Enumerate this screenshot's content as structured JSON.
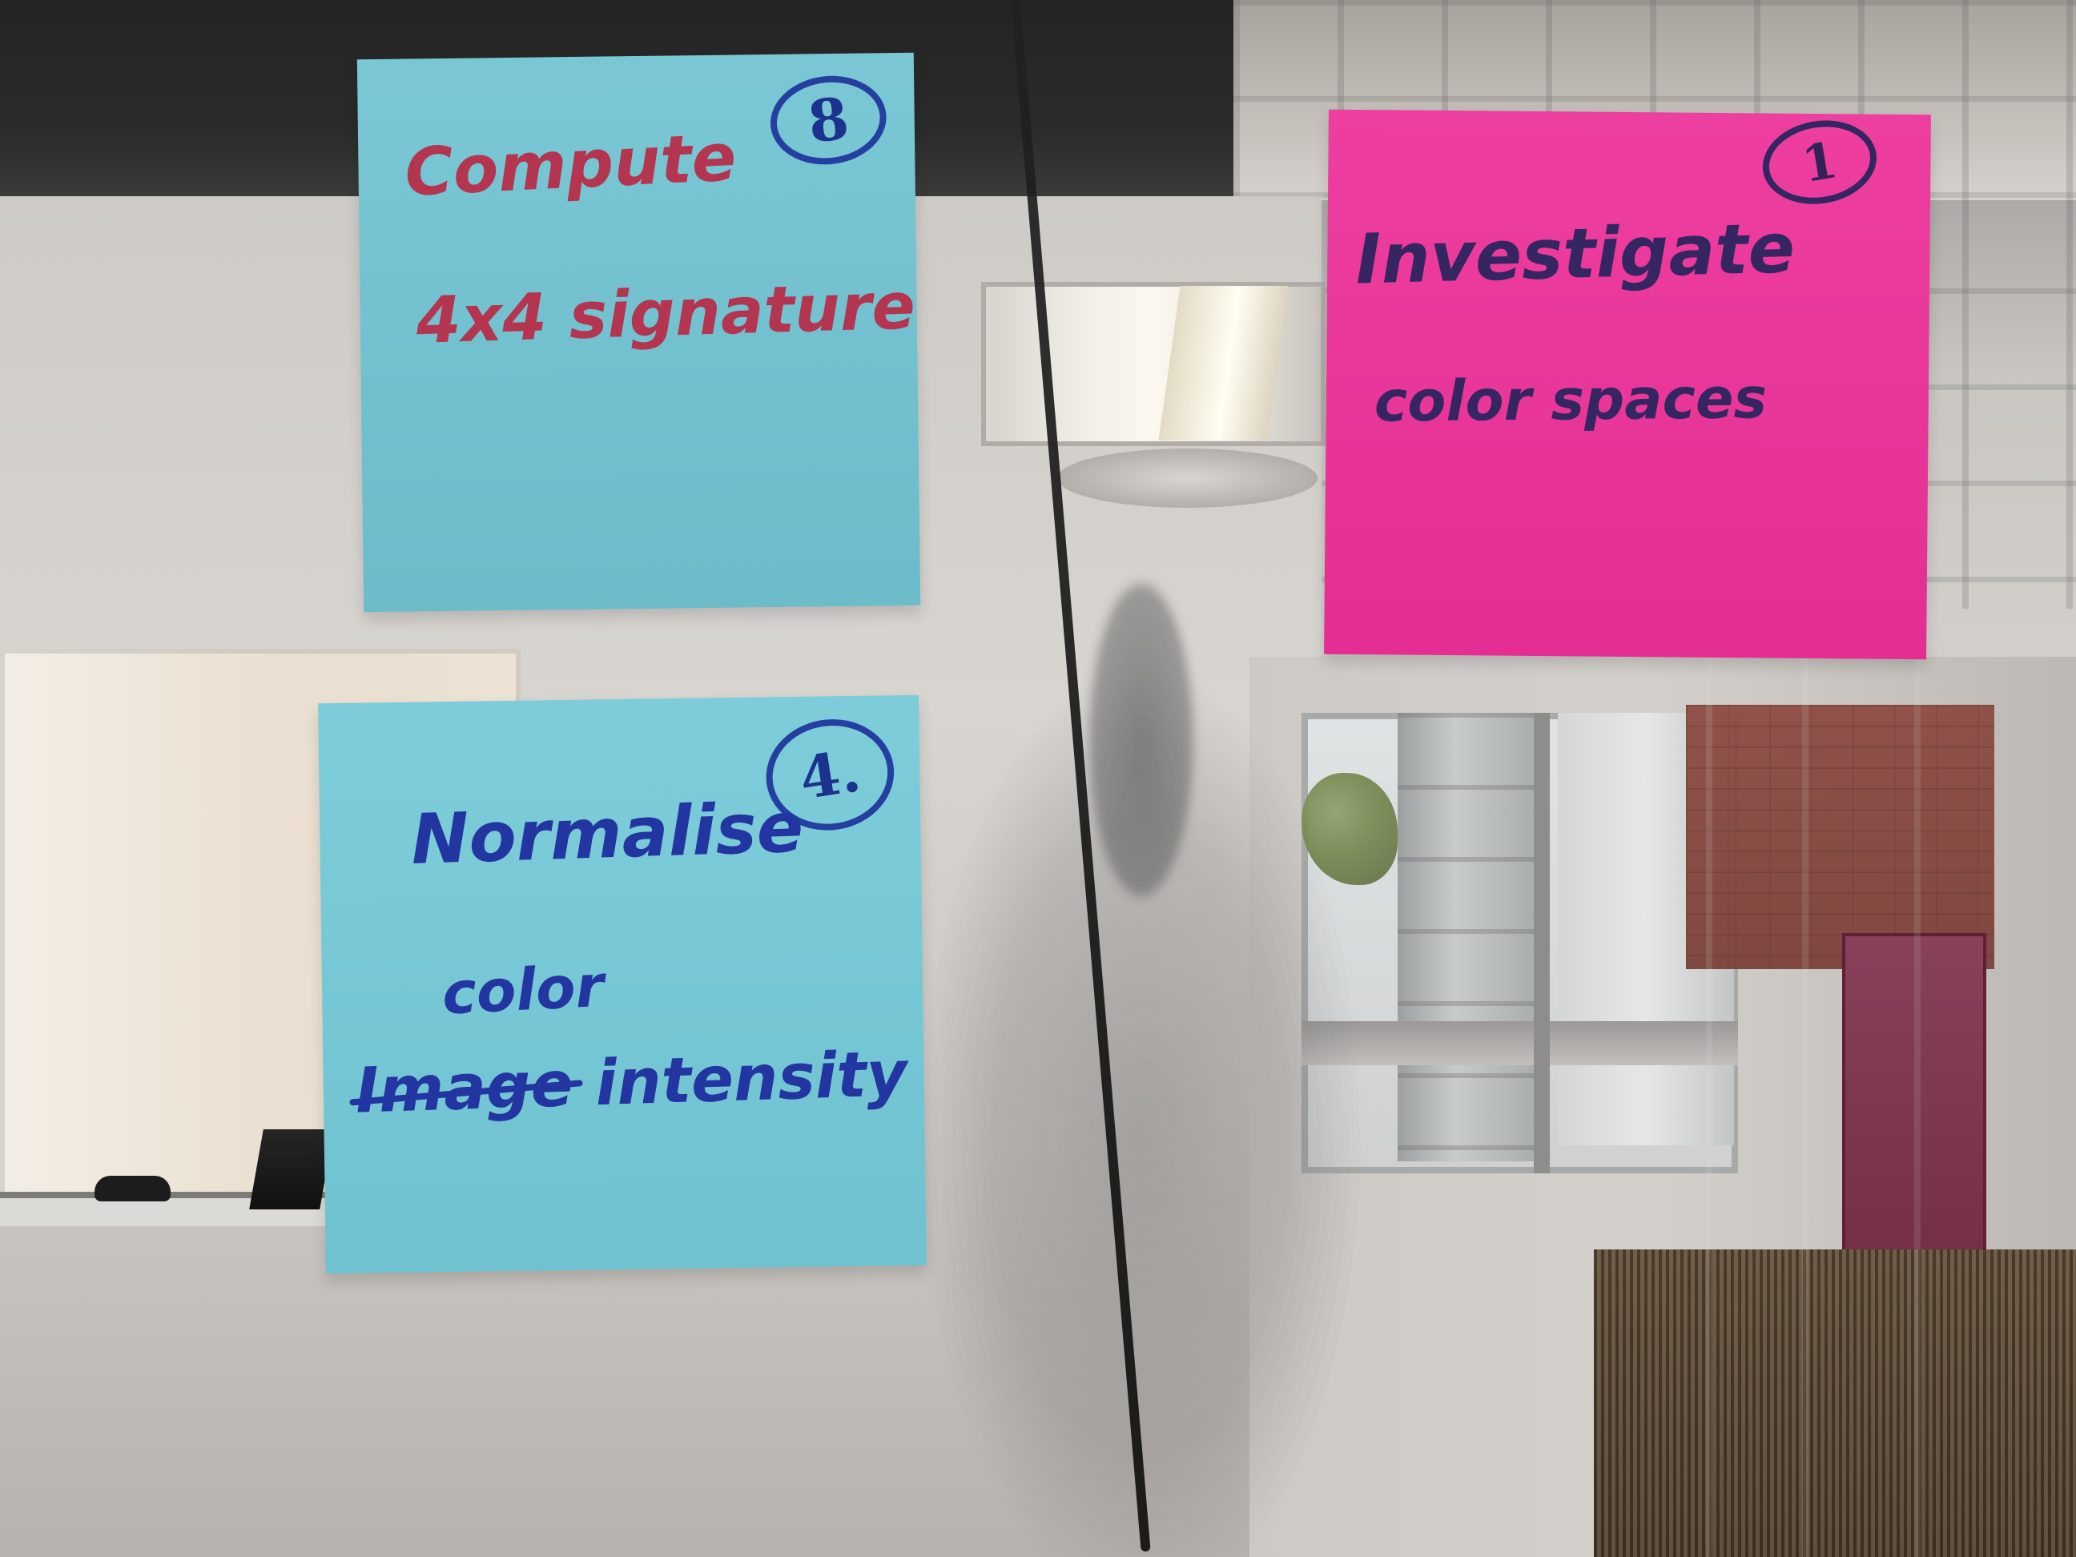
{
  "notes": {
    "compute": {
      "number": "8",
      "line1": "Compute",
      "line2": "4x4 signature"
    },
    "investigate": {
      "number": "1",
      "line1": "Investigate",
      "line2": "color spaces"
    },
    "normalise": {
      "number": "4.",
      "line1": "Normalise",
      "line2": "color",
      "crossed_word": "Image",
      "line3_tail": "intensity"
    }
  },
  "colors": {
    "cyan_note": "#72c5d5",
    "pink_note": "#ec2f98",
    "red_ink": "#b3354f",
    "blue_ink": "#2235a0",
    "purple_ink": "#352661"
  }
}
